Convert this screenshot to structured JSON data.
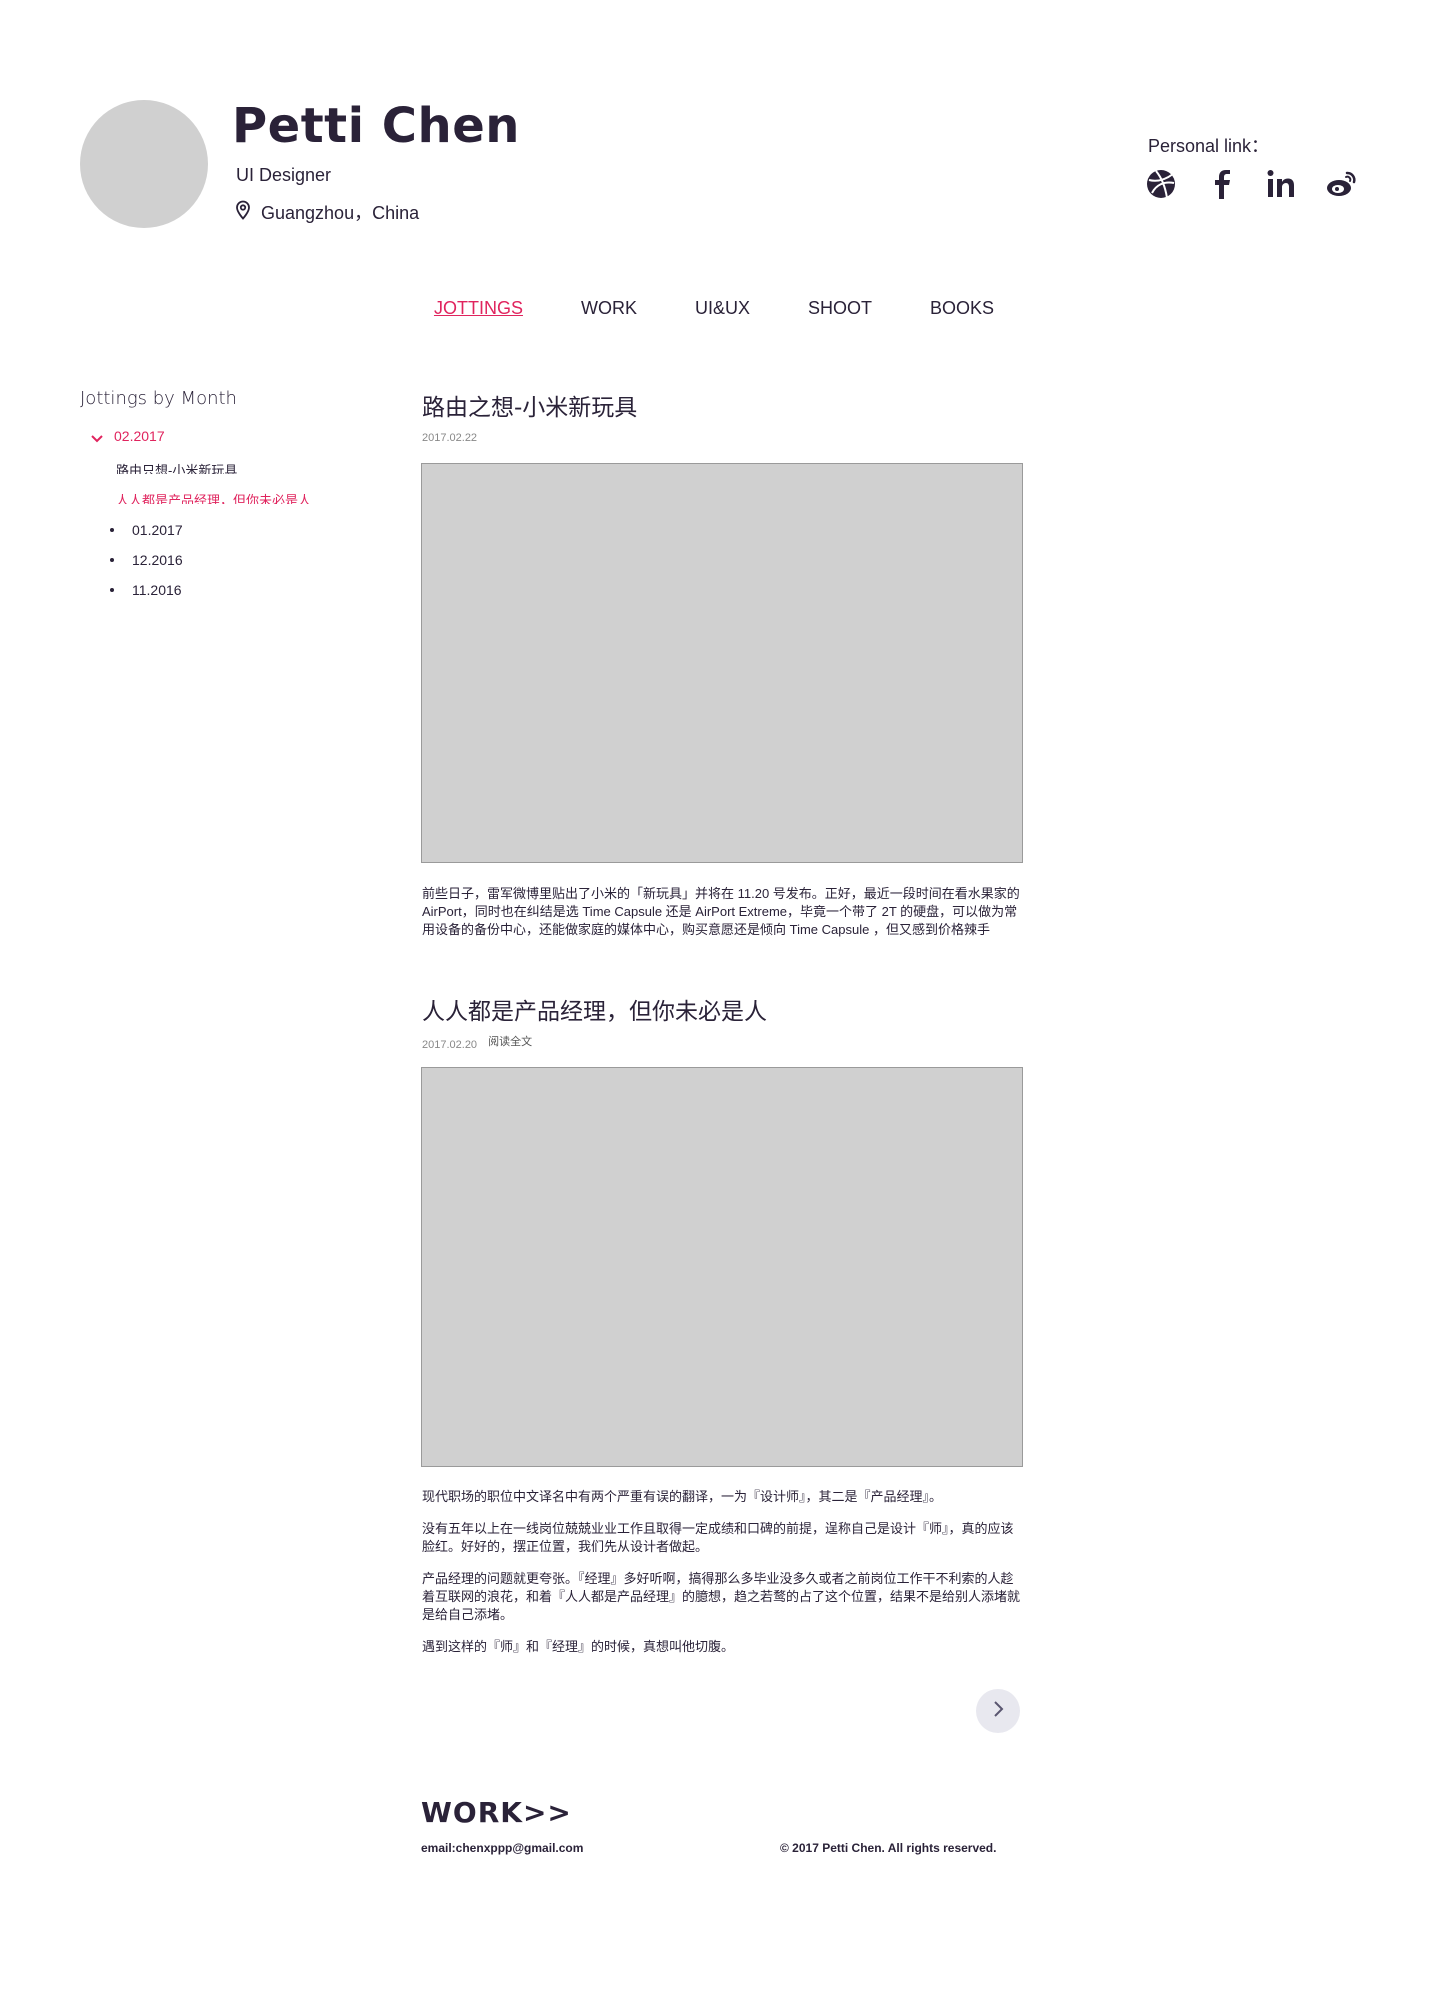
{
  "profile": {
    "name": "Petti Chen",
    "role": "UI Designer",
    "location": "Guangzhou，China"
  },
  "personal_links": {
    "label": "Personal link：",
    "items": [
      {
        "icon": "dribbble-icon"
      },
      {
        "icon": "facebook-icon"
      },
      {
        "icon": "linkedin-icon"
      },
      {
        "icon": "weibo-icon"
      }
    ]
  },
  "nav": {
    "items": [
      {
        "label": "JOTTINGS",
        "active": true
      },
      {
        "label": "WORK"
      },
      {
        "label": "UI&UX"
      },
      {
        "label": "SHOOT"
      },
      {
        "label": "BOOKS"
      }
    ]
  },
  "sidebar": {
    "title": "Jottings by Month",
    "expanded_month": "02.2017",
    "expanded_posts": [
      "路由只想-小米新玩具",
      "人人都是产品经理，但你未必是人"
    ],
    "months": [
      "01.2017",
      "12.2016",
      "11.2016"
    ]
  },
  "posts": [
    {
      "title": "路由之想-小米新玩具",
      "date": "2017.02.22",
      "paragraphs": [
        "前些日子，雷军微博里贴出了小米的「新玩具」并将在 11.20 号发布。正好，最近一段时间在看水果家的 AirPort，同时也在纠结是选 Time Capsule 还是 AirPort Extreme，毕竟一个带了 2T 的硬盘，可以做为常用设备的备份中心，还能做家庭的媒体中心，购买意愿还是倾向 Time Capsule ，但又感到价格辣手"
      ]
    },
    {
      "title": "人人都是产品经理，但你未必是人",
      "date": "2017.02.20",
      "read_more": "阅读全文",
      "paragraphs": [
        "现代职场的职位中文译名中有两个严重有误的翻译，一为『设计师』，其二是『产品经理』。",
        "没有五年以上在一线岗位兢兢业业工作且取得一定成绩和口碑的前提，逞称自己是设计『师』，真的应该脸红。好好的，摆正位置，我们先从设计者做起。",
        "产品经理的问题就更夸张。『经理』多好听啊，搞得那么多毕业没多久或者之前岗位工作干不利索的人趁着互联网的浪花，和着『人人都是产品经理』的臆想，趋之若鹜的占了这个位置，结果不是给别人添堵就是给自己添堵。",
        "遇到这样的『师』和『经理』的时候，真想叫他切腹。"
      ]
    }
  ],
  "pagination": {
    "next_icon": "chevron-right-icon"
  },
  "footer": {
    "work_link": "WORK>>",
    "email": "email:chenxppp@gmail.com",
    "copyright": "© 2017 Petti Chen. All rights reserved."
  },
  "colors": {
    "accent": "#e0245e",
    "text": "#2a2238",
    "placeholder": "#d0d0d0"
  }
}
